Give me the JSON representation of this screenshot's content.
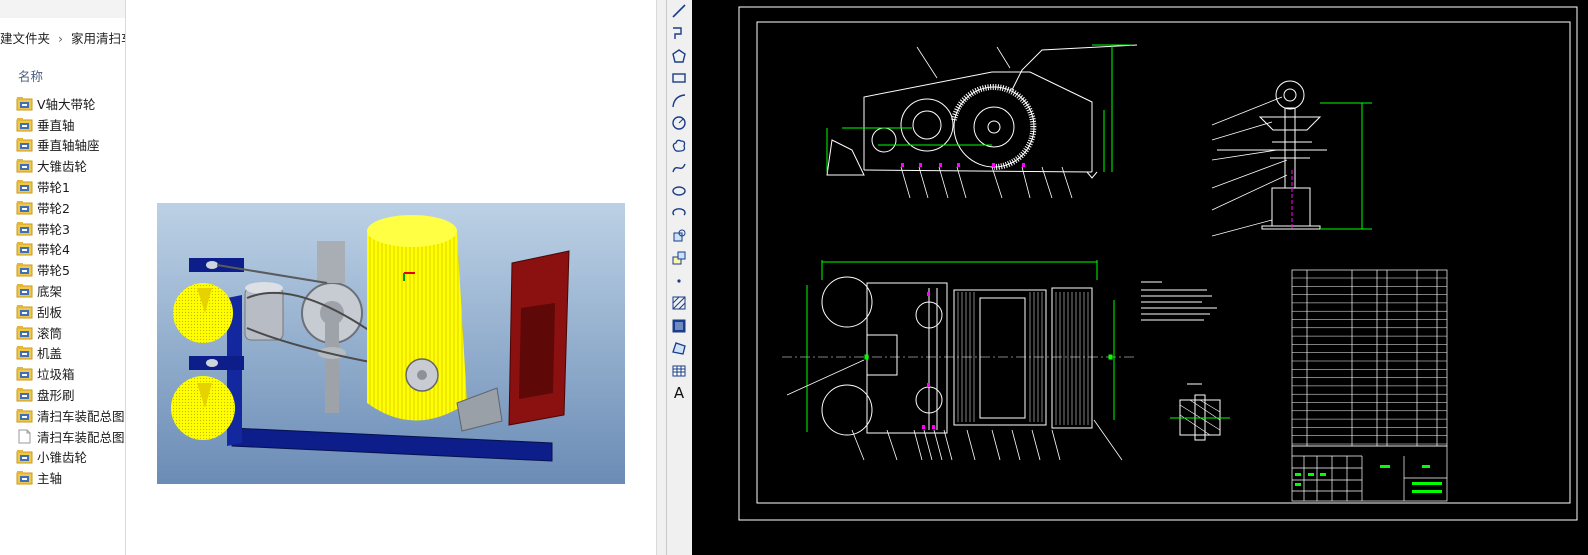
{
  "explorer": {
    "breadcrumb": [
      "建文件夹",
      "家用清扫车"
    ],
    "column_header": "名称",
    "items": [
      {
        "name": "V轴大带轮",
        "icon": "assembly-file-icon"
      },
      {
        "name": "垂直轴",
        "icon": "assembly-file-icon"
      },
      {
        "name": "垂直轴轴座",
        "icon": "assembly-file-icon"
      },
      {
        "name": "大锥齿轮",
        "icon": "assembly-file-icon"
      },
      {
        "name": "带轮1",
        "icon": "assembly-file-icon"
      },
      {
        "name": "带轮2",
        "icon": "assembly-file-icon"
      },
      {
        "name": "带轮3",
        "icon": "assembly-file-icon"
      },
      {
        "name": "带轮4",
        "icon": "assembly-file-icon"
      },
      {
        "name": "带轮5",
        "icon": "assembly-file-icon"
      },
      {
        "name": "底架",
        "icon": "assembly-file-icon"
      },
      {
        "name": "刮板",
        "icon": "assembly-file-icon"
      },
      {
        "name": "滚筒",
        "icon": "assembly-file-icon"
      },
      {
        "name": "机盖",
        "icon": "assembly-file-icon"
      },
      {
        "name": "垃圾箱",
        "icon": "assembly-file-icon"
      },
      {
        "name": "盘形刷",
        "icon": "assembly-file-icon"
      },
      {
        "name": "清扫车装配总图",
        "icon": "assembly-file-icon"
      },
      {
        "name": "清扫车装配总图.d",
        "icon": "blank-file-icon"
      },
      {
        "name": "小锥齿轮",
        "icon": "assembly-file-icon"
      },
      {
        "name": "主轴",
        "icon": "assembly-file-icon"
      }
    ]
  },
  "toolbar": {
    "tools": [
      "line-tool-icon",
      "polyline-tool-icon",
      "polygon-tool-icon",
      "rectangle-tool-icon",
      "arc-tool-icon",
      "circle-tool-icon",
      "revision-cloud-icon",
      "spline-tool-icon",
      "ellipse-tool-icon",
      "ellipse-arc-icon",
      "insert-block-icon",
      "make-block-icon",
      "point-tool-icon",
      "hatch-tool-icon",
      "gradient-tool-icon",
      "region-tool-icon",
      "table-tool-icon",
      "multiline-text-icon"
    ],
    "text_tool_label": "A"
  },
  "colors": {
    "cad_background": "#000000",
    "cad_lines": "#ffffff",
    "dimension_green": "#00ff00",
    "center_magenta": "#ff00ff",
    "brush_yellow": "#ffff00",
    "frame_navy": "#0d1d8a",
    "bin_red": "#8b1010",
    "preview_sky_top": "#b9cfe3",
    "preview_sky_bottom": "#6d8fb8"
  }
}
